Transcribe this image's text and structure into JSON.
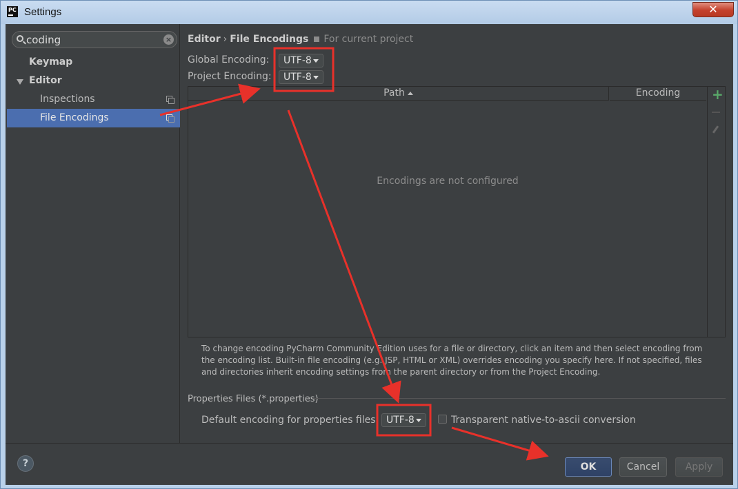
{
  "window": {
    "title": "Settings",
    "app_icon_text": "PC",
    "close_label": "✕"
  },
  "sidebar": {
    "search_value": "coding",
    "items": [
      {
        "label": "Keymap"
      },
      {
        "label": "Editor"
      },
      {
        "label": "Inspections"
      },
      {
        "label": "File Encodings",
        "selected": true
      }
    ]
  },
  "breadcrumb": {
    "parent": "Editor",
    "separator": "›",
    "current": "File Encodings",
    "scope": "For current project"
  },
  "encodings": {
    "global_label": "Global Encoding:",
    "global_value": "UTF-8",
    "project_label": "Project Encoding:",
    "project_value": "UTF-8"
  },
  "table": {
    "columns": [
      "Path",
      "Encoding"
    ],
    "empty_message": "Encodings are not configured",
    "add_icon": "+"
  },
  "help_text": "To change encoding PyCharm Community Edition uses for a file or directory, click an item and then select encoding from the encoding list. Built-in file encoding (e.g. JSP, HTML or XML) overrides encoding you specify here. If not specified, files and directories inherit encoding settings from the parent directory or from the Project Encoding.",
  "properties": {
    "group_title": "Properties Files (*.properties)",
    "default_label": "Default encoding for properties files:",
    "default_value": "UTF-8",
    "transparent_label": "Transparent native-to-ascii conversion",
    "transparent_checked": false
  },
  "footer": {
    "help_label": "?",
    "ok_label": "OK",
    "cancel_label": "Cancel",
    "apply_label": "Apply"
  },
  "colors": {
    "background": "#3c3f41",
    "selection": "#4b6eaf",
    "annotation_red": "#e8312a",
    "add_green": "#59a869"
  }
}
